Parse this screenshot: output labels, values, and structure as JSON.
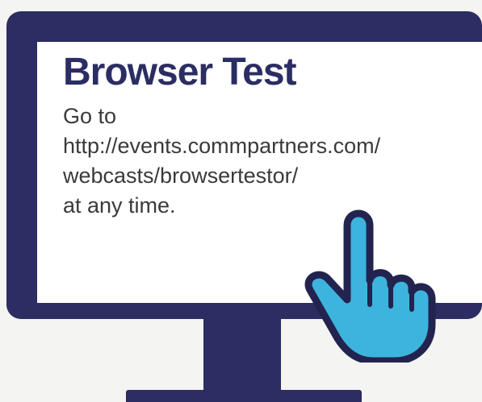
{
  "card": {
    "title": "Browser Test",
    "lines": [
      "Go to",
      "http://events.commpartners.com/",
      "webcasts/browsertestor/",
      "at any time."
    ]
  },
  "colors": {
    "frame": "#2b2d63",
    "screen": "#ffffff",
    "hand_fill": "#3cb4de",
    "hand_outline": "#22244f",
    "text": "#3a3a3a"
  },
  "icons": {
    "monitor": "monitor-icon",
    "pointer": "pointing-hand-icon"
  }
}
